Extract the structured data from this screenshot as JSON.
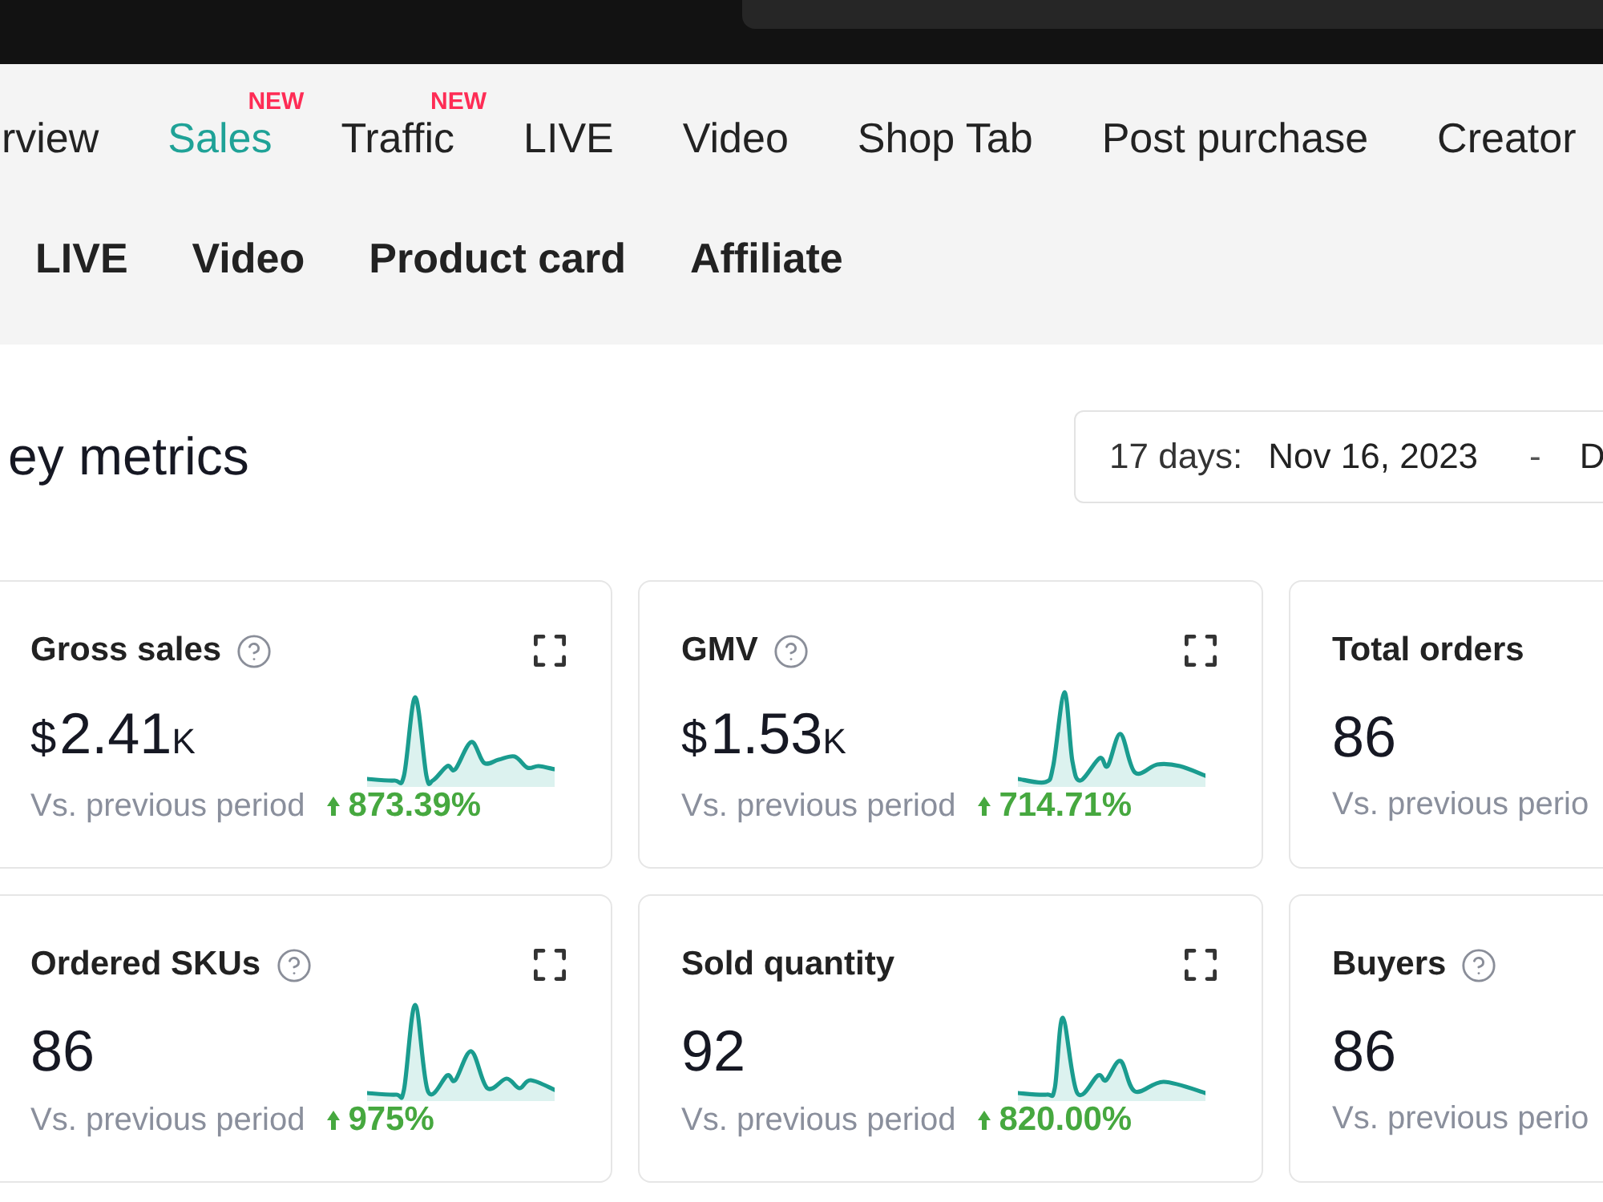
{
  "tabs": [
    {
      "label": "rview",
      "selected": false
    },
    {
      "label": "Sales",
      "selected": true,
      "badge": "NEW"
    },
    {
      "label": "Traffic",
      "selected": false,
      "badge": "NEW"
    },
    {
      "label": "LIVE",
      "selected": false
    },
    {
      "label": "Video",
      "selected": false
    },
    {
      "label": "Shop Tab",
      "selected": false
    },
    {
      "label": "Post purchase",
      "selected": false
    },
    {
      "label": "Creator",
      "selected": false
    }
  ],
  "subtabs": [
    {
      "label": "LIVE",
      "selected": false
    },
    {
      "label": "Video",
      "selected": false
    },
    {
      "label": "Product card",
      "selected": false
    },
    {
      "label": "Affiliate",
      "selected": false
    }
  ],
  "section": {
    "title": "ey metrics",
    "date_range": {
      "label": "17 days:",
      "start": "Nov 16, 2023",
      "separator": "-",
      "end": "D"
    }
  },
  "metrics": [
    {
      "title": "Gross sales",
      "help": true,
      "expand_button": true,
      "currency": "$",
      "value": "2.41",
      "unit": "K",
      "trend_chart": true,
      "comparison": "Vs. previous period",
      "increase": true,
      "change": "873.39%"
    },
    {
      "title": "GMV",
      "help": true,
      "expand_button": true,
      "currency": "$",
      "value": "1.53",
      "unit": "K",
      "trend_chart": true,
      "comparison": "Vs. previous period",
      "increase": true,
      "change": "714.71%"
    },
    {
      "title": "Total orders",
      "help": false,
      "expand_button": false,
      "value": "86",
      "trend_chart": false,
      "comparison": "Vs. previous perio"
    },
    {
      "title": "Ordered SKUs",
      "help": true,
      "expand_button": true,
      "value": "86",
      "trend_chart": true,
      "comparison": "Vs. previous period",
      "increase": true,
      "change": "975%"
    },
    {
      "title": "Sold quantity",
      "help": false,
      "expand_button": true,
      "value": "92",
      "trend_chart": true,
      "comparison": "Vs. previous period",
      "increase": true,
      "change": "820.00%"
    },
    {
      "title": "Buyers",
      "help": true,
      "expand_button": false,
      "value": "86",
      "trend_chart": false,
      "comparison": "Vs. previous perio"
    }
  ]
}
